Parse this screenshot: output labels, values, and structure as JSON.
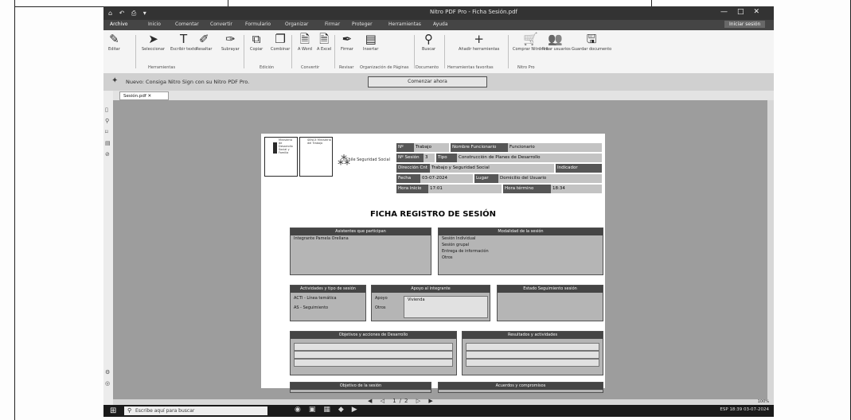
{
  "window": {
    "title": "Nitro PDF Pro - Ficha Sesión.pdf",
    "quick_access": "⌂ ↶ ⎙ ▾"
  },
  "menu": {
    "tabs": [
      "Archivo",
      "Inicio",
      "Comentar",
      "Convertir",
      "Formulario",
      "Organizar",
      "Firmar",
      "Proteger",
      "Herramientas",
      "Ayuda"
    ],
    "right": "Iniciar sesión"
  },
  "ribbon": {
    "buttons": [
      {
        "label": "Editar",
        "icon": "pencil-icon"
      },
      {
        "label": "Seleccionar",
        "icon": "cursor-icon"
      },
      {
        "label": "Escribir texto",
        "icon": "text-icon"
      },
      {
        "label": "Resaltar",
        "icon": "pen-icon"
      },
      {
        "label": "Subrayar",
        "icon": "marker-icon"
      },
      {
        "label": "Copiar",
        "icon": "copy-icon"
      },
      {
        "label": "Combinar",
        "icon": "combine-icon"
      },
      {
        "label": "A Word",
        "icon": "word-icon"
      },
      {
        "label": "A Excel",
        "icon": "excel-icon"
      },
      {
        "label": "Firmar",
        "icon": "sign-icon"
      },
      {
        "label": "Insertar",
        "icon": "insert-icon"
      },
      {
        "label": "Buscar",
        "icon": "search-icon"
      },
      {
        "label": "Añadir herramientas",
        "icon": "plus-icon"
      },
      {
        "label": "Comprar Nitro Pro",
        "icon": "cart-icon"
      },
      {
        "label": "Invitar usuarios",
        "icon": "users-icon"
      },
      {
        "label": "Guardar documento",
        "icon": "save-icon"
      }
    ],
    "groups": [
      "Herramientas",
      "Edición",
      "Convertir",
      "Revisar",
      "Organización de Páginas",
      "Documento",
      "Herramientas favoritas",
      "Nitro Pro"
    ]
  },
  "notification": {
    "message": "Nuevo: Consiga Nitro Sign con su Nitro PDF Pro.",
    "button": "Comenzar ahora"
  },
  "doc_tab": {
    "label": "Sesión.pdf"
  },
  "page": {
    "logo1": "Ministerio de Desarrollo Social y Familia",
    "logo2": "SENCE Ministerio del Trabajo",
    "emblem": "Chile Seguridad Social",
    "header_rows": [
      {
        "k1": "Nº",
        "v1": "Trabajo",
        "k2": "Nombre Funcionario",
        "v2": "Funcionario"
      },
      {
        "k1": "Nº Sesión",
        "v1": "3",
        "k2": "Tipo",
        "v2": "Construcción de Planes de Desarrollo"
      },
      {
        "k1": "Dirección Cnt",
        "v1": "Trabajo y Seguridad Social",
        "k2": "Indicador",
        "v2": ""
      },
      {
        "k1": "Fecha",
        "v1": "03-07-2024",
        "k2": "Lugar",
        "v2": "Domicilio del Usuario"
      },
      {
        "k1": "Hora inicio",
        "v1": "17:01",
        "k2": "Hora término",
        "v2": "18:34"
      }
    ],
    "title": "FICHA REGISTRO DE SESIÓN",
    "box_participants": {
      "header": "Asistentes que participan",
      "row": "Integrante Pamela Orellana"
    },
    "box_modality": {
      "header": "Modalidad de la sesión",
      "rows": [
        "Sesión Individual",
        "Sesión grupal",
        "Entrega de información",
        "Otros"
      ]
    },
    "box_activities": {
      "header": "Actividades y tipo de sesión",
      "rows": [
        "ACTI - Línea temática",
        "AS - Seguimiento"
      ]
    },
    "box_support": {
      "header": "Apoyo al integrante",
      "rows": [
        "Apoyo",
        "Otros"
      ],
      "value": "Vivienda"
    },
    "box_state": {
      "header": "Estado Seguimiento sesión"
    },
    "box_objectives": {
      "header": "Objetivos y acciones de Desarrollo"
    },
    "box_results": {
      "header": "Resultados y actividades"
    },
    "box_goal": {
      "header": "Objetivo de la sesión"
    },
    "box_agreements": {
      "header": "Acuerdos y compromisos"
    }
  },
  "status": {
    "nav": "◀ ◁ 1/2 ▷ ▶",
    "zoom": "100%"
  },
  "taskbar": {
    "search": "Escribe aquí para buscar",
    "tray": "ESP 18:39 03-07-2024"
  }
}
